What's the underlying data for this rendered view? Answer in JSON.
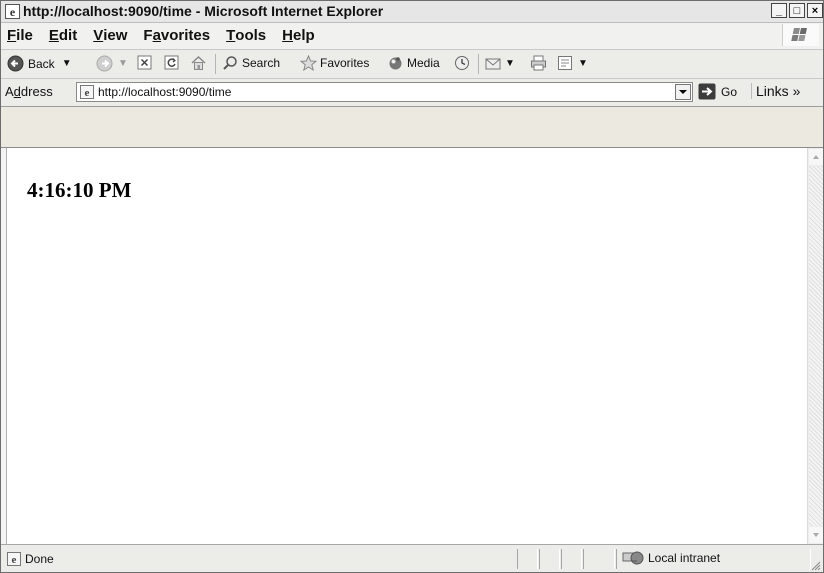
{
  "window": {
    "title": "http://localhost:9090/time - Microsoft Internet Explorer",
    "minimize": "_",
    "maximize": "□",
    "close": "×"
  },
  "menu": {
    "items": [
      {
        "accel": "F",
        "rest": "ile"
      },
      {
        "accel": "E",
        "rest": "dit"
      },
      {
        "accel": "V",
        "rest": "iew"
      },
      {
        "pre": "F",
        "accel": "a",
        "rest": "vorites"
      },
      {
        "accel": "T",
        "rest": "ools"
      },
      {
        "accel": "H",
        "rest": "elp"
      }
    ]
  },
  "toolbar": {
    "back_label": "Back",
    "search_label": "Search",
    "favorites_label": "Favorites",
    "media_label": "Media"
  },
  "address": {
    "label_pre": "A",
    "label_accel": "d",
    "label_post": "dress",
    "url": "http://localhost:9090/time",
    "go_label": "Go",
    "links_label": "Links »"
  },
  "page": {
    "time": "4:16:10 PM"
  },
  "status": {
    "text": "Done",
    "zone": "Local intranet"
  },
  "colors": {
    "chrome": "#ece9e1",
    "go_arrow": "#2f7d32"
  }
}
